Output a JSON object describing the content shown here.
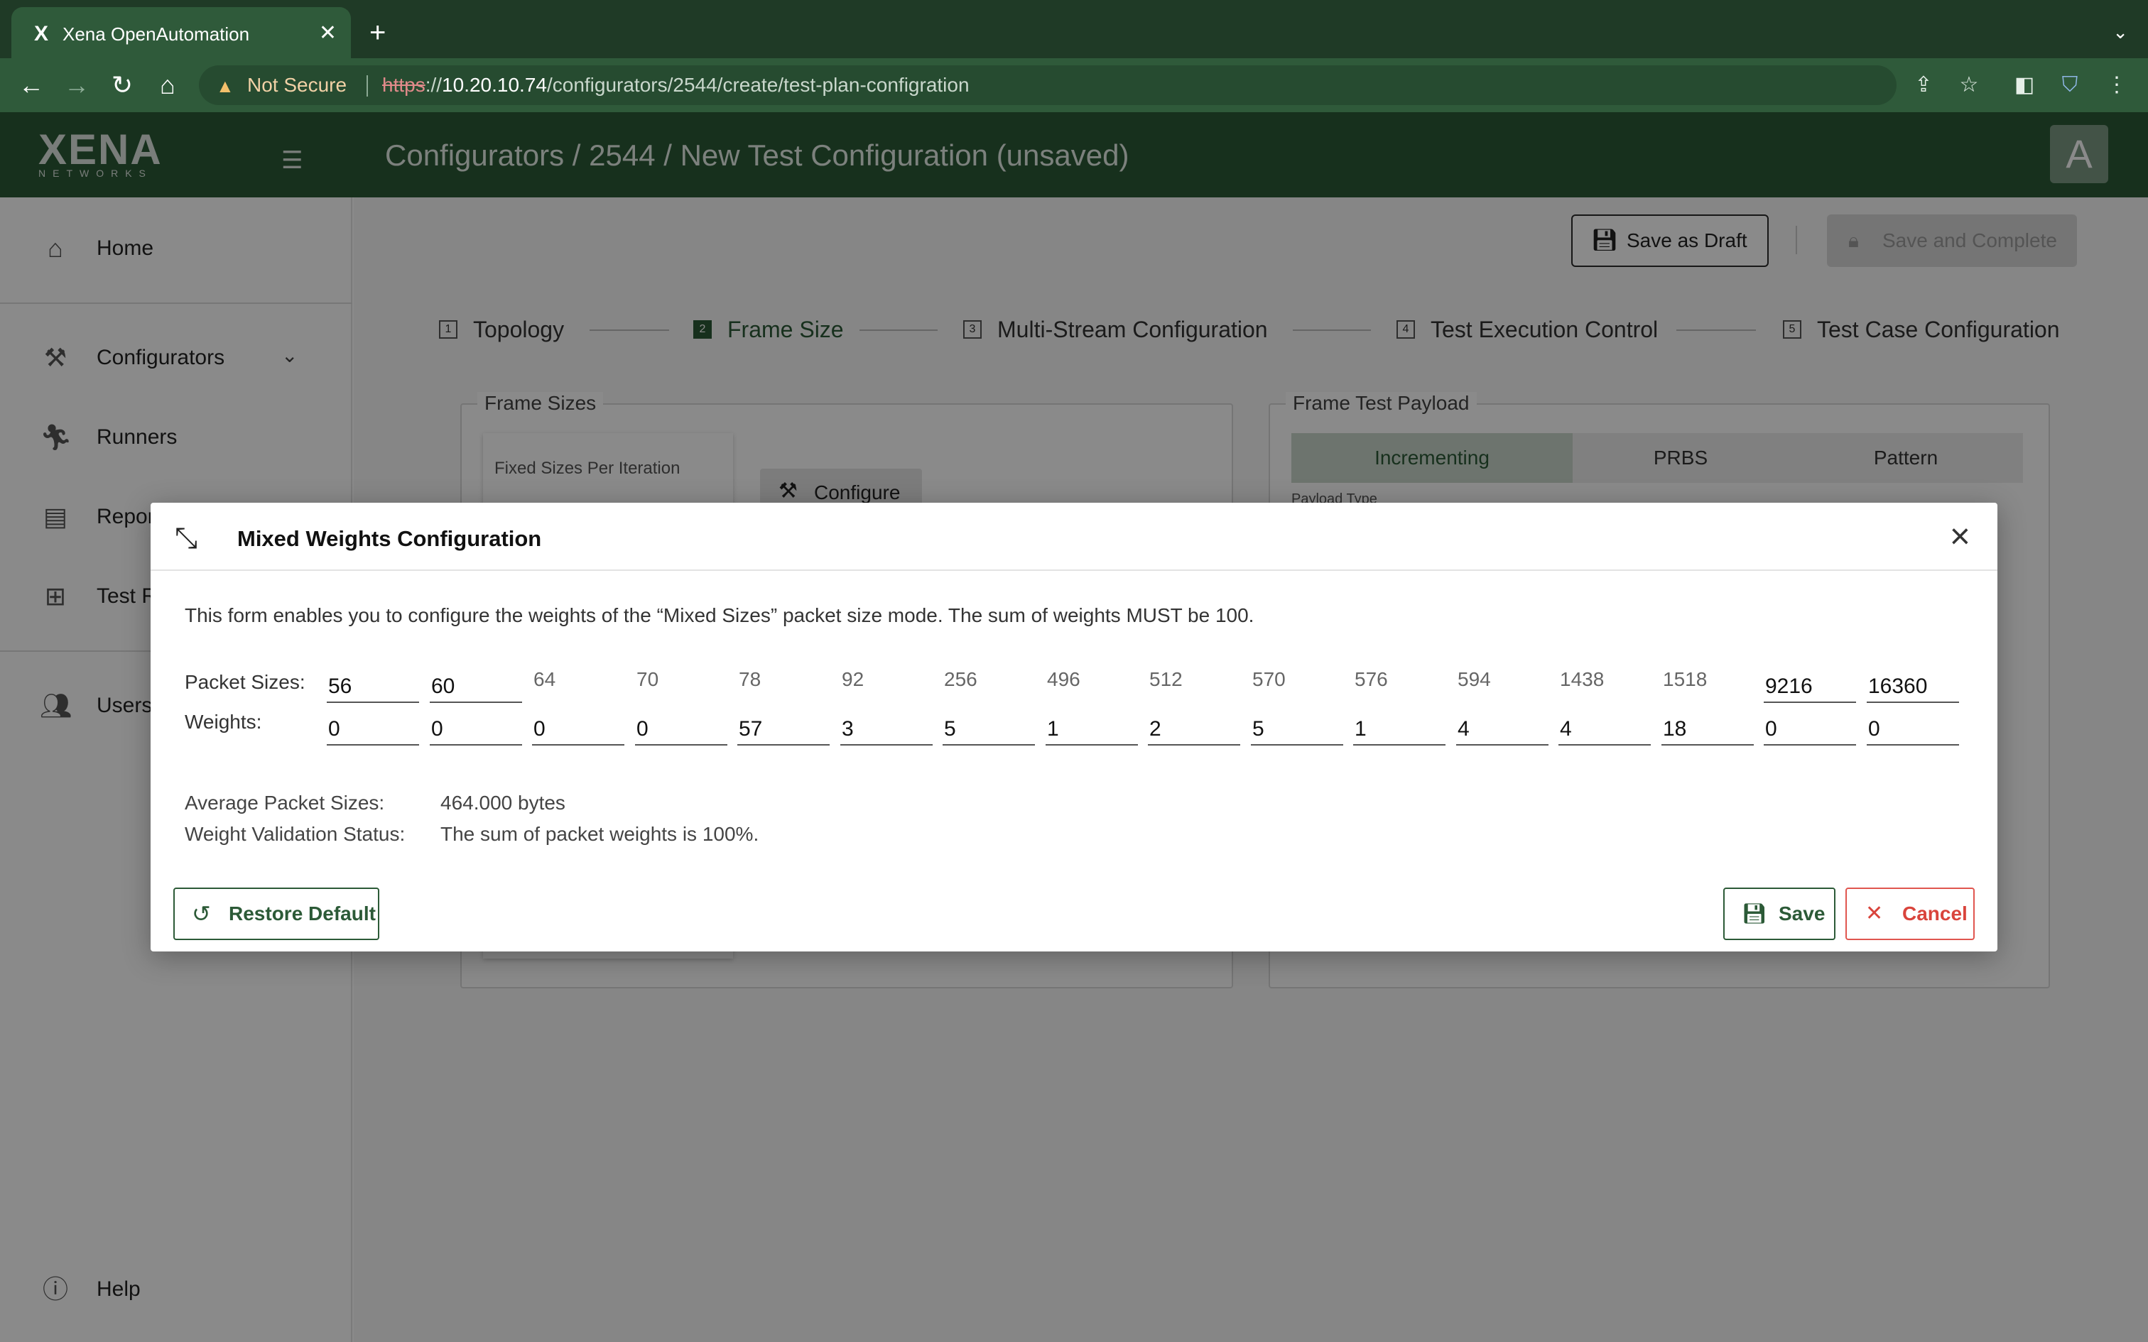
{
  "browser": {
    "tab_title": "Xena OpenAutomation",
    "tab_favicon": "X",
    "not_secure": "Not Secure",
    "url_scheme": "https",
    "url_sep": "://",
    "url_host": "10.20.10.74",
    "url_path": "/configurators/2544/create/test-plan-configration"
  },
  "app": {
    "logo_big": "XENA",
    "logo_small": "NETWORKS",
    "breadcrumb": "Configurators / 2544 / New Test Configuration (unsaved)",
    "avatar": "A",
    "accent": "#2c5a37"
  },
  "sidebar": {
    "home": "Home",
    "configurators": "Configurators",
    "runners": "Runners",
    "reports": "Repor",
    "test_resources": "Test R",
    "users": "Users",
    "help": "Help"
  },
  "toolbar": {
    "save_draft": "Save as Draft",
    "save_complete": "Save and Complete"
  },
  "steps": [
    {
      "num": "1",
      "label": "Topology"
    },
    {
      "num": "2",
      "label": "Frame Size"
    },
    {
      "num": "3",
      "label": "Multi-Stream Configuration"
    },
    {
      "num": "4",
      "label": "Test Execution Control"
    },
    {
      "num": "5",
      "label": "Test Case Configuration"
    }
  ],
  "frame_sizes": {
    "legend": "Frame Sizes",
    "fixed_label": "Fixed Sizes Per Iteration",
    "configure": "Configure"
  },
  "payload": {
    "legend": "Frame Test Payload",
    "options": [
      "Incrementing",
      "PRBS",
      "Pattern"
    ],
    "payload_type": "Payload Type"
  },
  "modal": {
    "title": "Mixed Weights Configuration",
    "description": "This form enables you to configure the weights of the “Mixed Sizes” packet size mode. The sum of weights MUST be 100.",
    "packet_sizes_label": "Packet Sizes:",
    "weights_label": "Weights:",
    "packet_sizes": [
      "56",
      "60",
      "64",
      "70",
      "78",
      "92",
      "256",
      "496",
      "512",
      "570",
      "576",
      "594",
      "1438",
      "1518",
      "9216",
      "16360"
    ],
    "packet_size_editable": [
      true,
      true,
      false,
      false,
      false,
      false,
      false,
      false,
      false,
      false,
      false,
      false,
      false,
      false,
      true,
      true
    ],
    "weights": [
      "0",
      "0",
      "0",
      "0",
      "57",
      "3",
      "5",
      "1",
      "2",
      "5",
      "1",
      "4",
      "4",
      "18",
      "0",
      "0"
    ],
    "avg_label": "Average Packet Sizes:",
    "avg_value": "464.000 bytes",
    "status_label": "Weight Validation Status:",
    "status_value": "The sum of packet weights is 100%.",
    "restore": "Restore Default",
    "save": "Save",
    "cancel": "Cancel"
  }
}
